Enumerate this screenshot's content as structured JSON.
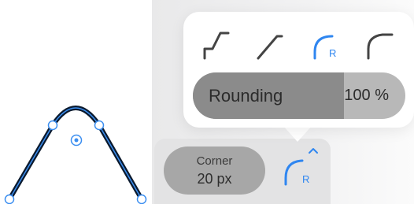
{
  "editor": {
    "shape": "rounded-peak-path",
    "handle_color": "#3b8ef0",
    "stroke_color": "#0b1a2e"
  },
  "toolbar": {
    "corner_label": "Corner",
    "corner_value": "20 px",
    "mode_icon": "rounded-corner-icon",
    "mode_badge": "R",
    "expand_icon": "chevron-up-icon"
  },
  "popover": {
    "styles": [
      {
        "name": "chamfer-corner-icon",
        "selected": false
      },
      {
        "name": "straight-corner-icon",
        "selected": false
      },
      {
        "name": "rounded-corner-icon",
        "selected": true,
        "badge": "R"
      },
      {
        "name": "smooth-corner-icon",
        "selected": false
      }
    ],
    "slider": {
      "label": "Rounding",
      "value_text": "100 %",
      "fill_fraction": 0.71
    },
    "accent": "#2f86f0"
  }
}
